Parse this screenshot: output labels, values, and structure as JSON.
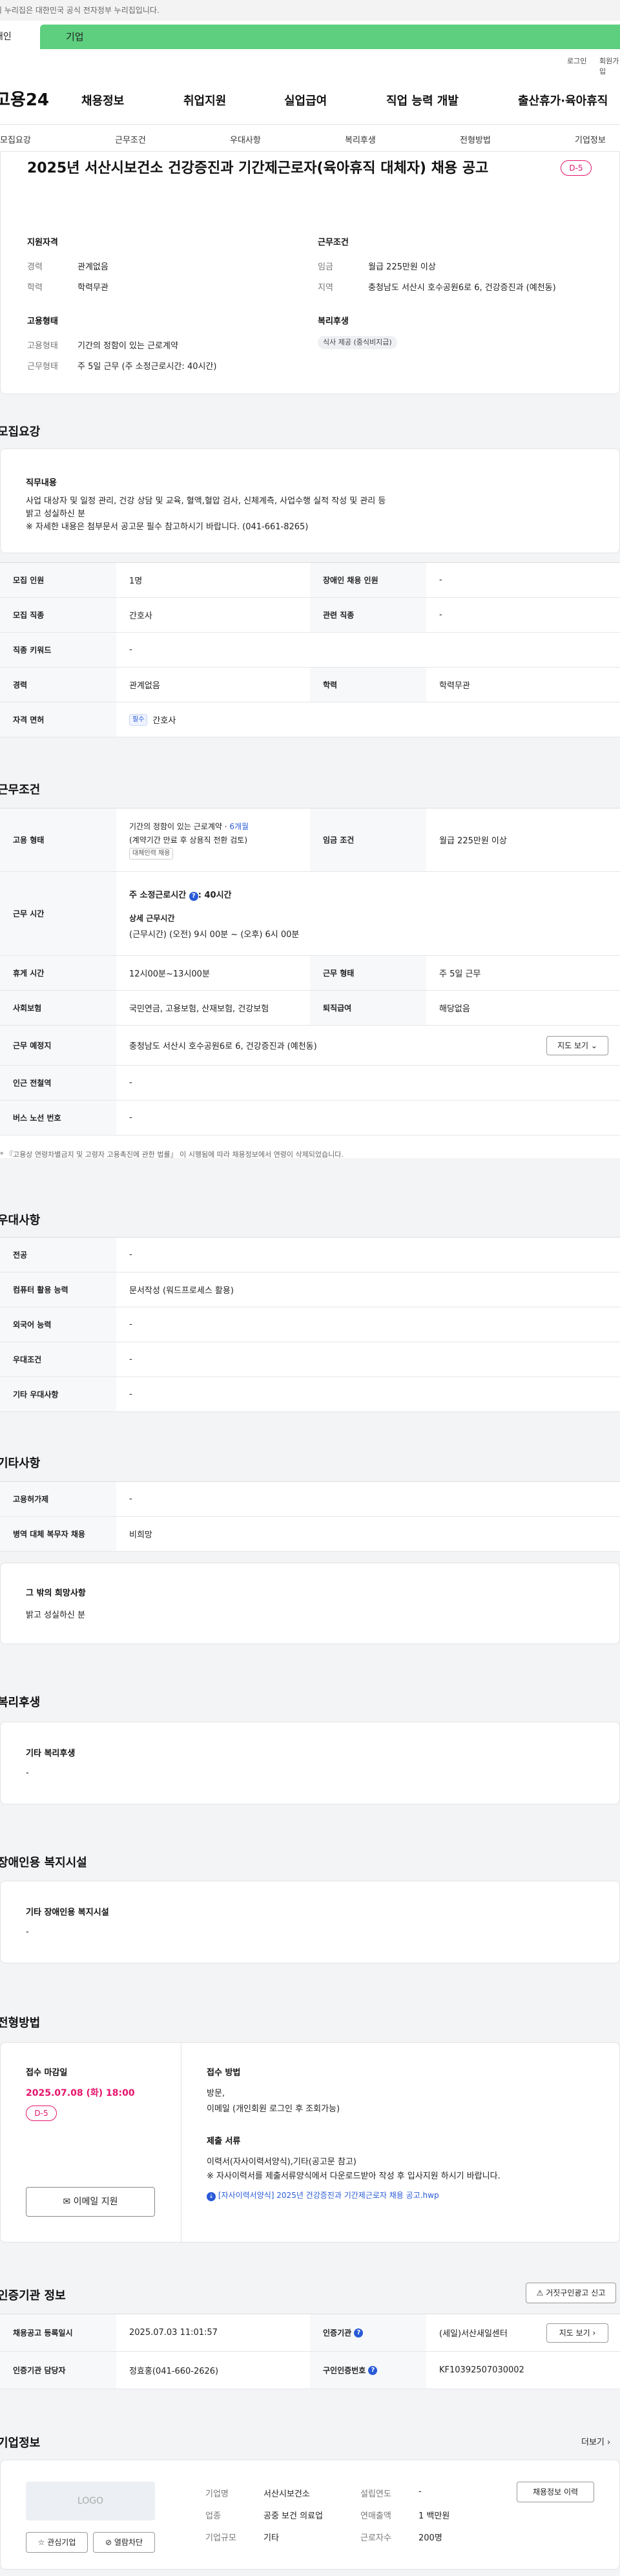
{
  "topbar": {
    "notice": "이 누리집은 대한민국 공식 전자정부 누리집입니다."
  },
  "tabs": {
    "left": "개인",
    "right": "기업"
  },
  "util": {
    "login": "로그인",
    "join": "회원가입"
  },
  "logo": "고용24",
  "gnb": [
    "채용정보",
    "취업지원",
    "실업급여",
    "직업 능력 개발",
    "출산휴가·육아휴직"
  ],
  "subnav": [
    "모집요강",
    "근무조건",
    "우대사항",
    "복리후생",
    "전형방법",
    "기업정보"
  ],
  "summary": {
    "title": "2025년 서산시보건소 건강증진과 기간제근로자(육아휴직 대체자) 채용 공고",
    "dday": "D-5",
    "qual_head": "지원자격",
    "qual": [
      {
        "label": "경력",
        "value": "관계없음"
      },
      {
        "label": "학력",
        "value": "학력무관"
      }
    ],
    "cond_head": "근무조건",
    "cond": [
      {
        "label": "임금",
        "value": "월급 225만원 이상"
      },
      {
        "label": "지역",
        "value": "충청남도 서산시 호수공원6로 6, 건강증진과 (예천동)"
      }
    ],
    "emp_head": "고용형태",
    "emp": [
      {
        "label": "고용형태",
        "value": "기간의 정함이 있는 근로계약"
      },
      {
        "label": "근무형태",
        "value": "주 5일 근무 (주 소정근로시간: 40시간)"
      }
    ],
    "welfare_head": "복리후생",
    "welfare_chip": "식사 제공 (중식비지급)"
  },
  "recruit": {
    "heading": "모집요강",
    "duty_head": "직무내용",
    "duty_text1": "사업 대상자 및 일정 관리, 건강 상담 및 교육, 혈액,혈압 검사, 신체계측, 사업수행 실적 작성 및 관리 등",
    "duty_text2": "밝고 성실하신 분",
    "duty_text3": "※ 자세한 내용은 첨부문서 공고문 필수 참고하시기 바랍니다. (041-661-8265)",
    "rows": {
      "r1": {
        "th1": "모집 인원",
        "td1": "1명",
        "th2": "장애인 채용 인원",
        "td2": "-"
      },
      "r2": {
        "th1": "모집 직종",
        "td1": "간호사",
        "th2": "관련 직종",
        "td2": "-"
      },
      "r3": {
        "th1": "직종 키워드",
        "td1": "-"
      },
      "r4": {
        "th1": "경력",
        "td1": "관계없음",
        "th2": "학력",
        "td2": "학력무관"
      },
      "r5": {
        "th1": "자격 면허",
        "tag": "필수",
        "td1": "간호사"
      }
    }
  },
  "work": {
    "heading": "근무조건",
    "emp_th": "고용 형태",
    "emp_v1": "기간의 정함이 있는 근로계약 · ",
    "emp_v1b": "6개월",
    "emp_v2": "(계약기간 만료 후 상용직 전환 검토)",
    "emp_tag": "대체인력 채용",
    "wage_th": "임금 조건",
    "wage_td": "월급 225만원 이상",
    "time_th": "근무 시간",
    "time_v1": "주 소정근로시간",
    "time_v1b": ": 40시간",
    "time_v2": "상세 근무시간",
    "time_v3": "(근무시간) (오전) 9시 00분 ~ (오후) 6시 00분",
    "rest_th": "휴게 시간",
    "rest_td": "12시00분~13시00분",
    "form_th": "근무 형태",
    "form_td": "주 5일 근무",
    "ins_th": "사회보험",
    "ins_td": "국민연금, 고용보험, 산재보험, 건강보험",
    "ret_th": "퇴직급여",
    "ret_td": "해당없음",
    "place_th": "근무 예정지",
    "place_td": "충청남도 서산시 호수공원6로 6, 건강증진과 (예천동)",
    "map_btn": "지도 보기",
    "sub_th": "인근 전철역",
    "sub_td": "-",
    "bus_th": "버스 노선 번호",
    "bus_td": "-",
    "note": "* 『고용상 연령차별금지 및 고령자 고용촉진에 관한 법률』 이 시행됨에 따라 채용정보에서 연령이 삭제되었습니다."
  },
  "pref": {
    "heading": "우대사항",
    "rows": [
      {
        "th": "전공",
        "td": "-"
      },
      {
        "th": "컴퓨터 활용 능력",
        "td": "문서작성 (워드프로세스 활용)"
      },
      {
        "th": "외국어 능력",
        "td": "-"
      },
      {
        "th": "우대조건",
        "td": "-"
      },
      {
        "th": "기타 우대사항",
        "td": "-"
      }
    ]
  },
  "etc": {
    "heading": "기타사항",
    "rows": [
      {
        "th": "고용허가제",
        "td": "-"
      },
      {
        "th": "병역 대체 복무자 채용",
        "td": "비희망"
      }
    ],
    "hope_head": "그 밖의 희망사항",
    "hope_text": "밝고 성실하신 분"
  },
  "welfare": {
    "heading": "복리후생",
    "box_head": "기타 복리후생",
    "box_text": "-"
  },
  "disabled": {
    "heading": "장애인용 복지시설",
    "box_head": "기타 장애인용 복지시설",
    "box_text": "-"
  },
  "apply": {
    "heading": "전형방법",
    "deadline_head": "접수 마감일",
    "deadline": "2025.07.08 (화) 18:00",
    "dday": "D-5",
    "email_btn": "이메일 지원",
    "method_head": "접수 방법",
    "method_v1": "방문,",
    "method_v2": "이메일 (개인회원 로그인 후 조회가능)",
    "docs_head": "제출 서류",
    "docs_v1": "이력서(자사이력서양식),기타(공고문 참고)",
    "docs_v2": "※ 자사이력서를 제출서류양식에서 다운로드받아 작성 후 입사지원 하시기 바랍니다.",
    "file": "[자사이력서양식] 2025년 건강증진과 기간제근로자 채용 공고.hwp"
  },
  "cert": {
    "heading": "인증기관 정보",
    "report_btn": "거짓구인광고 신고",
    "rows": {
      "r1": {
        "th1": "채용공고 등록일시",
        "td1": "2025.07.03 11:01:57",
        "th2": "인증기관",
        "td2": "(세일)서산새일센터",
        "btn": "지도 보기"
      },
      "r2": {
        "th1": "인증기관 담당자",
        "td1": "정효홍(041-660-2626)",
        "th2": "구인인증번호",
        "td2": "KF10392507030002"
      }
    }
  },
  "company": {
    "heading": "기업정보",
    "more": "더보기",
    "logo_text": "LOGO",
    "fav_btn": "관심기업",
    "block_btn": "열람차단",
    "history_btn": "채용정보 이력",
    "fields": [
      {
        "label": "기업명",
        "value": "서산시보건소",
        "label2": "설립연도",
        "value2": "-"
      },
      {
        "label": "업종",
        "value": "공중 보건 의료업",
        "label2": "연매출액",
        "value2": "1 백만원"
      },
      {
        "label": "기업규모",
        "value": "기타",
        "label2": "근로자수",
        "value2": "200명"
      }
    ]
  }
}
